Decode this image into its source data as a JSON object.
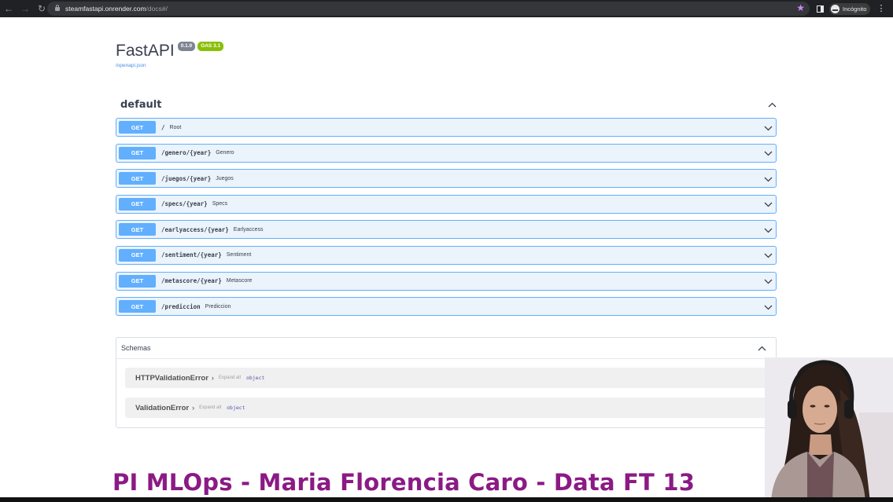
{
  "browser": {
    "url_host": "steamfastapi.onrender.com",
    "url_path": "/docs#/",
    "profile_label": "Incógnito"
  },
  "api": {
    "title": "FastAPI",
    "version": "0.1.0",
    "oas": "OAS 3.1",
    "spec_link": "/openapi.json"
  },
  "tag": {
    "name": "default"
  },
  "operations": [
    {
      "method": "GET",
      "path": "/",
      "summary": "Root"
    },
    {
      "method": "GET",
      "path": "/genero/{year}",
      "summary": "Genero"
    },
    {
      "method": "GET",
      "path": "/juegos/{year}",
      "summary": "Juegos"
    },
    {
      "method": "GET",
      "path": "/specs/{year}",
      "summary": "Specs"
    },
    {
      "method": "GET",
      "path": "/earlyaccess/{year}",
      "summary": "Earlyaccess"
    },
    {
      "method": "GET",
      "path": "/sentiment/{year}",
      "summary": "Sentiment"
    },
    {
      "method": "GET",
      "path": "/metascore/{year}",
      "summary": "Metascore"
    },
    {
      "method": "GET",
      "path": "/prediccion",
      "summary": "Prediccion"
    }
  ],
  "schemas": {
    "title": "Schemas",
    "models": [
      {
        "name": "HTTPValidationError",
        "expand_label": "Expand all",
        "type": "object"
      },
      {
        "name": "ValidationError",
        "expand_label": "Expand all",
        "type": "object"
      }
    ]
  },
  "caption": "PI MLOps - Maria Florencia Caro - Data FT 13",
  "colors": {
    "get_method": "#61affe",
    "get_bg": "#ebf3fb",
    "caption": "#8b1a85",
    "oas_badge": "#89bf04",
    "version_badge": "#7d8492"
  }
}
